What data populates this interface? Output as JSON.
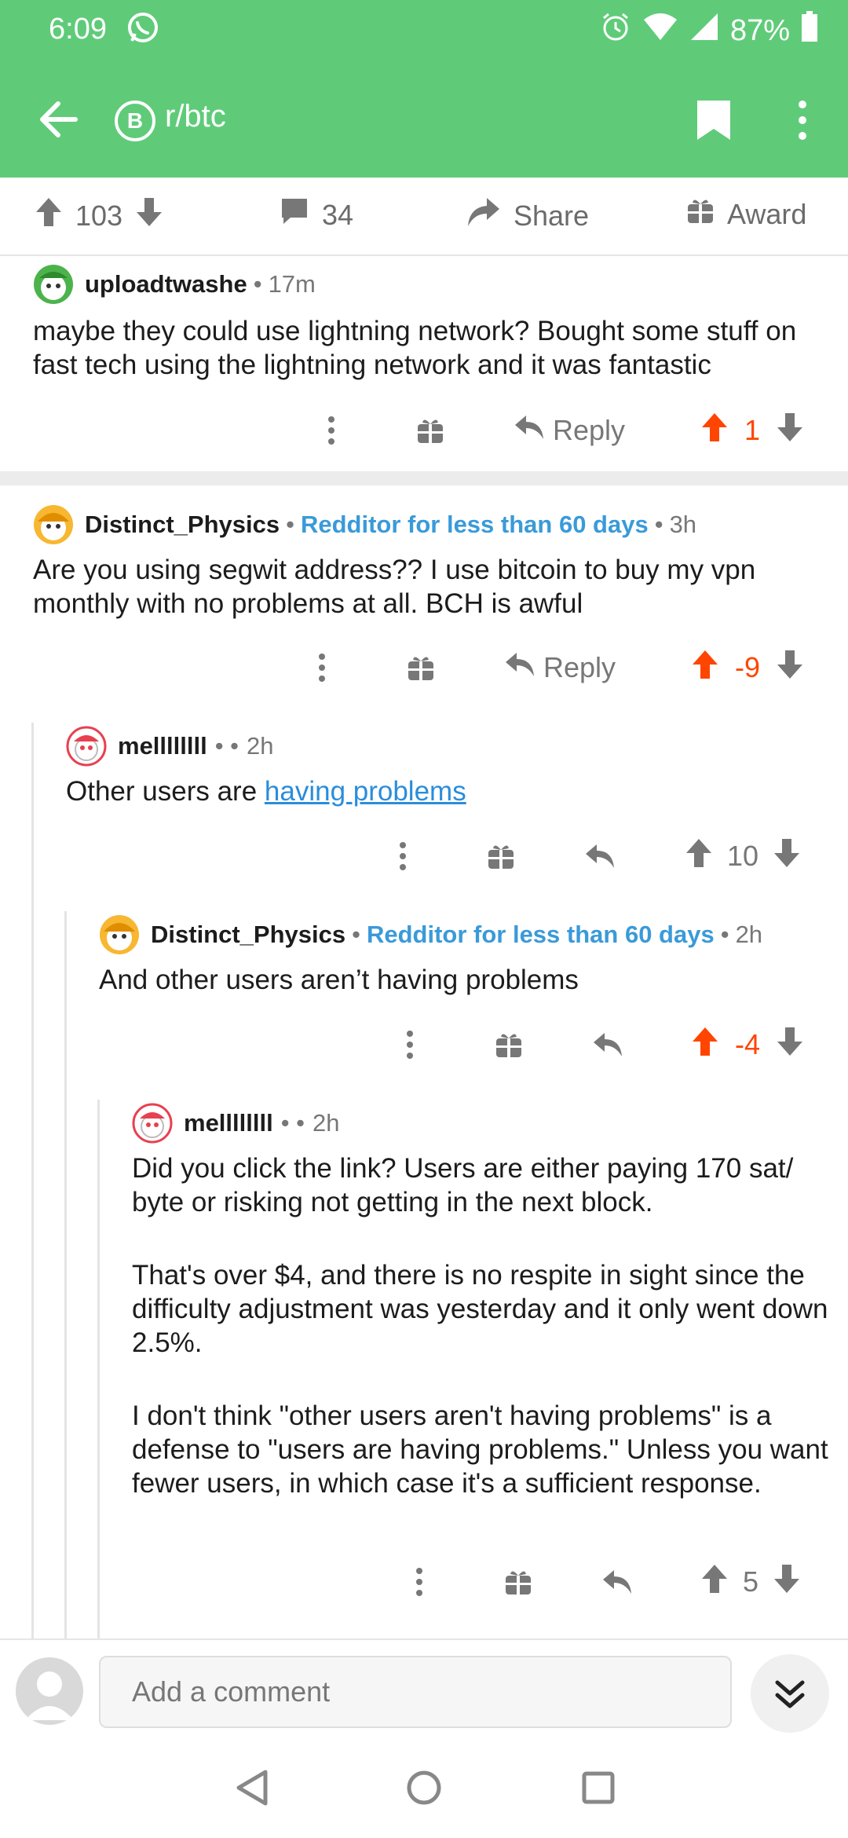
{
  "status": {
    "time": "6:09",
    "battery": "87%"
  },
  "appbar": {
    "subreddit": "r/btc",
    "icon_letter": "B"
  },
  "post_actions": {
    "score": "103",
    "comments": "34",
    "share": "Share",
    "award": "Award"
  },
  "comments": [
    {
      "user": "uploadtwashe",
      "flair": "",
      "sep": "•",
      "age": "17m",
      "body": [
        "maybe they could use lightning network? Bought some stuff on fast tech using the lightning network and it was fantastic"
      ],
      "reply": "Reply",
      "score": "1"
    },
    {
      "user": "Distinct_Physics",
      "flair": "Redditor for less than 60 days",
      "sep": "•",
      "age": "3h",
      "body": [
        "Are you using segwit address?? I use bitcoin to buy my vpn monthly with no problems at all. BCH is awful"
      ],
      "reply": "Reply",
      "score": "-9"
    },
    {
      "user": "mellllllll",
      "flair": "",
      "sep": "• •",
      "age": "2h",
      "body_prefix": "Other users are ",
      "link": "having problems",
      "score": "10"
    },
    {
      "user": "Distinct_Physics",
      "flair": "Redditor for less than 60 days",
      "sep": "•",
      "age": "2h",
      "body": [
        "And other users aren’t having problems"
      ],
      "score": "-4"
    },
    {
      "user": "mellllllll",
      "flair": "",
      "sep": "• •",
      "age": "2h",
      "body": [
        "Did you click the link? Users are either paying 170 sat/ byte or risking not getting in the next block.",
        "That's over $4, and there is no respite in sight since the difficulty adjustment was yesterday and it only went down 2.5%.",
        "I don't think \"other users aren't having problems\" is a defense to \"users are having problems.\" Unless you want fewer users, in which case it's a sufficient response."
      ],
      "score": "5"
    }
  ],
  "composer": {
    "placeholder": "Add a comment"
  },
  "colors": {
    "header": "#5fcb79",
    "upvote": "#ff4500",
    "flair": "#3a9ad9",
    "link": "#2a8ddb"
  }
}
